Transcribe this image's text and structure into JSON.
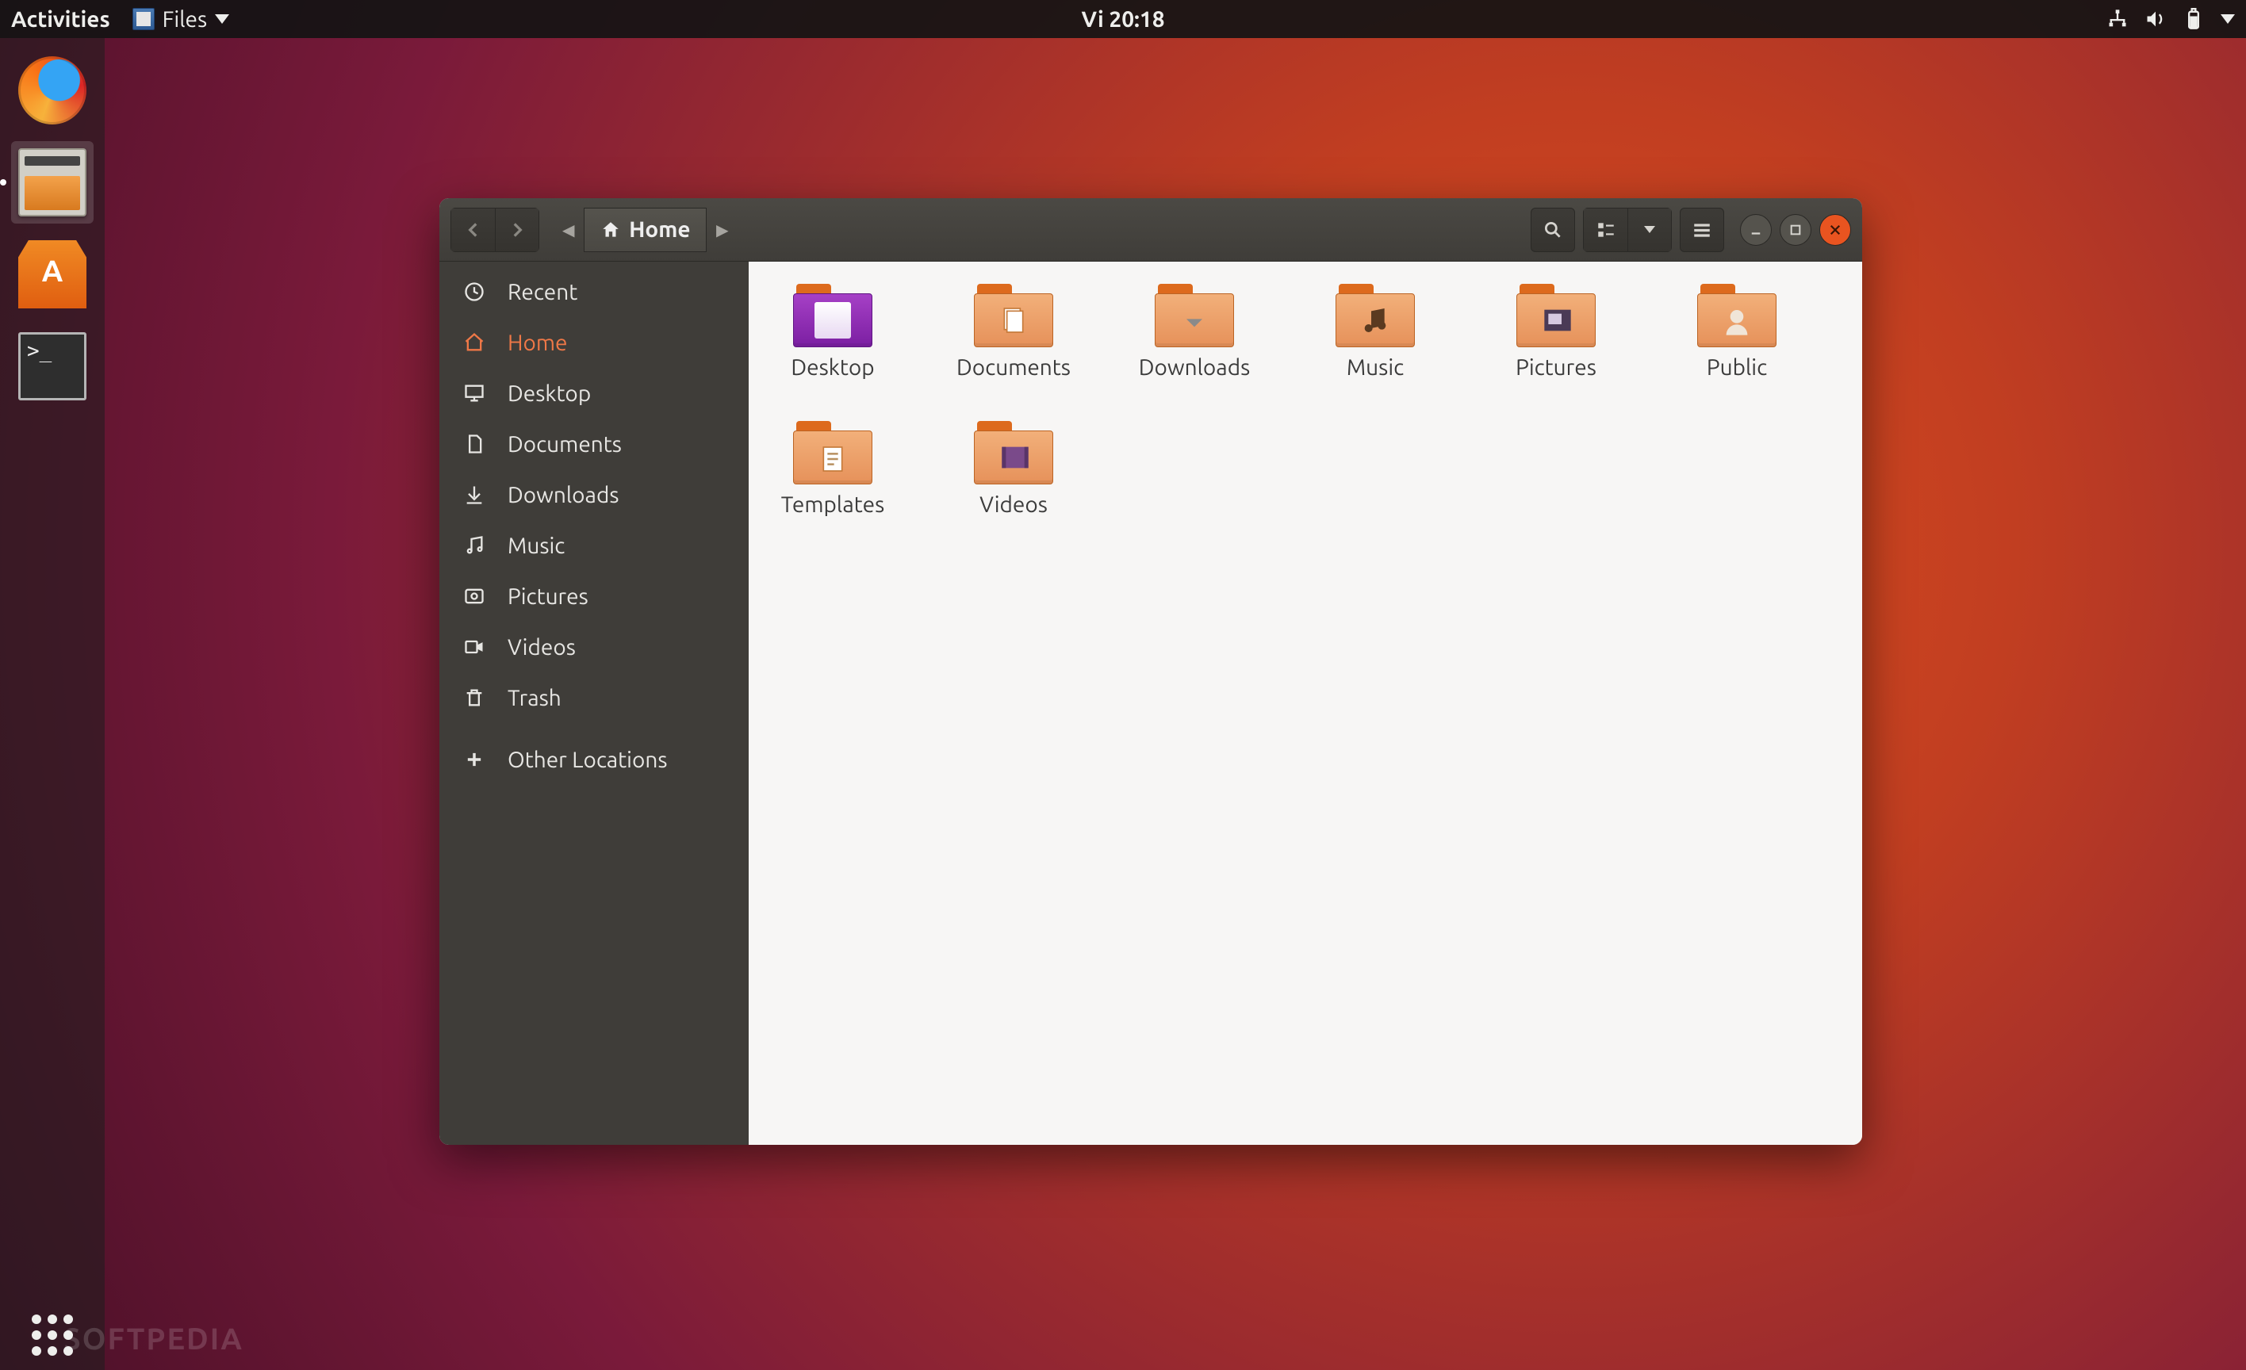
{
  "panel": {
    "activities": "Activities",
    "app_menu_label": "Files",
    "clock": "Vi 20:18"
  },
  "dock": {
    "items": [
      {
        "name": "firefox",
        "active": false
      },
      {
        "name": "files",
        "active": true
      },
      {
        "name": "ubuntu-software",
        "active": false
      },
      {
        "name": "terminal",
        "active": false
      }
    ]
  },
  "window": {
    "path_label": "Home",
    "sidebar": [
      {
        "icon": "recent",
        "label": "Recent",
        "selected": false
      },
      {
        "icon": "home",
        "label": "Home",
        "selected": true
      },
      {
        "icon": "desktop",
        "label": "Desktop",
        "selected": false
      },
      {
        "icon": "documents",
        "label": "Documents",
        "selected": false
      },
      {
        "icon": "downloads",
        "label": "Downloads",
        "selected": false
      },
      {
        "icon": "music",
        "label": "Music",
        "selected": false
      },
      {
        "icon": "pictures",
        "label": "Pictures",
        "selected": false
      },
      {
        "icon": "videos",
        "label": "Videos",
        "selected": false
      },
      {
        "icon": "trash",
        "label": "Trash",
        "selected": false
      },
      {
        "icon": "other",
        "label": "Other Locations",
        "selected": false,
        "separated": true
      }
    ],
    "folders": [
      {
        "label": "Desktop",
        "kind": "desktop"
      },
      {
        "label": "Documents",
        "kind": "documents"
      },
      {
        "label": "Downloads",
        "kind": "downloads"
      },
      {
        "label": "Music",
        "kind": "music"
      },
      {
        "label": "Pictures",
        "kind": "pictures"
      },
      {
        "label": "Public",
        "kind": "public"
      },
      {
        "label": "Templates",
        "kind": "templates"
      },
      {
        "label": "Videos",
        "kind": "videos"
      }
    ]
  },
  "watermark": "SOFTPEDIA"
}
